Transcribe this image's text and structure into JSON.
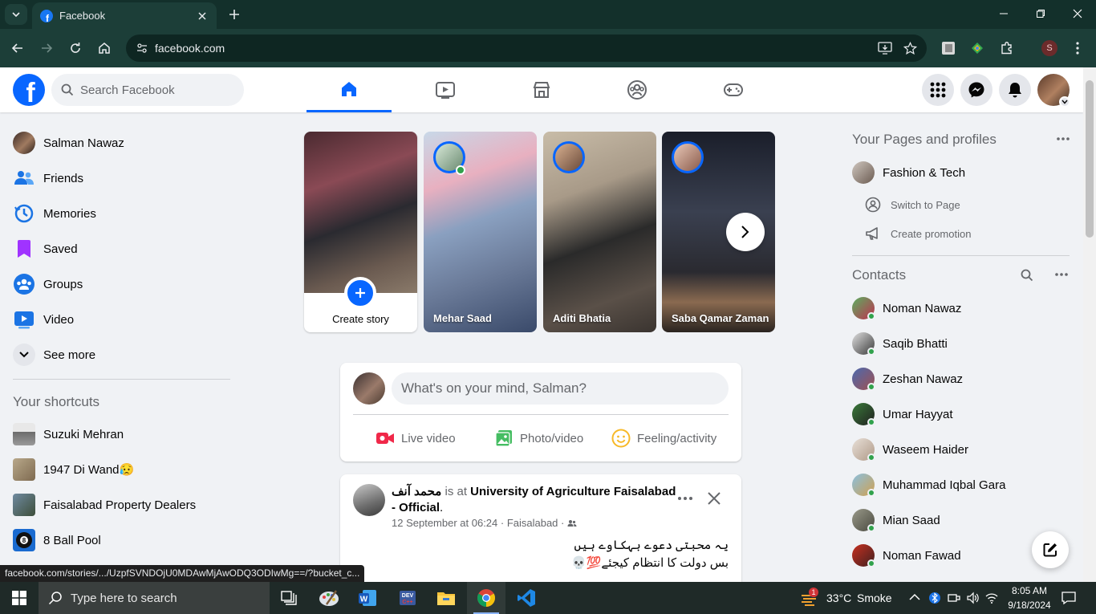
{
  "browser": {
    "tab_title": "Facebook",
    "url": "facebook.com",
    "profile_initial": "S",
    "status_url": "facebook.com/stories/.../UzpfSVNDOjU0MDAwMjAwODQ3ODIwMg==/?bucket_c..."
  },
  "header": {
    "logo_letter": "f",
    "search_placeholder": "Search Facebook",
    "nav_tabs": [
      "home-icon",
      "video-icon",
      "marketplace-icon",
      "groups-icon",
      "gaming-icon"
    ],
    "accent": "#0866ff"
  },
  "left": {
    "items": [
      {
        "label": "Salman Nawaz",
        "icon": "avatar"
      },
      {
        "label": "Friends",
        "icon": "friends-icon"
      },
      {
        "label": "Memories",
        "icon": "memories-icon"
      },
      {
        "label": "Saved",
        "icon": "saved-icon"
      },
      {
        "label": "Groups",
        "icon": "groups-icon"
      },
      {
        "label": "Video",
        "icon": "video-icon"
      },
      {
        "label": "See more",
        "icon": "chevron-down-icon"
      }
    ],
    "shortcuts_title": "Your shortcuts",
    "shortcuts": [
      {
        "label": "Suzuki Mehran"
      },
      {
        "label": "1947 Di Wand😥"
      },
      {
        "label": "Faisalabad Property Dealers"
      },
      {
        "label": "8 Ball Pool"
      }
    ]
  },
  "stories": {
    "create_label": "Create story",
    "items": [
      {
        "name": "Mehar Saad"
      },
      {
        "name": "Aditi Bhatia"
      },
      {
        "name": "Saba Qamar Zaman"
      }
    ]
  },
  "composer": {
    "placeholder": "What's on your mind, Salman?",
    "live_label": "Live video",
    "photo_label": "Photo/video",
    "feeling_label": "Feeling/activity"
  },
  "post": {
    "author": "محمد آنف",
    "is_at": " is at ",
    "place": "University of Agriculture Faisalabad - Official",
    "period": ".",
    "date": "12 September at 06:24 · Faisalabad ·",
    "line1": "یہ محبتی دعوے بہکاوے ہیں",
    "line2": "بس دولت کا انتظام کیجئے💯💀"
  },
  "right": {
    "pages_title": "Your Pages and profiles",
    "page_name": "Fashion & Tech",
    "switch_label": "Switch to Page",
    "promo_label": "Create promotion",
    "contacts_title": "Contacts",
    "contacts": [
      {
        "name": "Noman Nawaz"
      },
      {
        "name": "Saqib Bhatti"
      },
      {
        "name": "Zeshan Nawaz"
      },
      {
        "name": "Umar Hayyat"
      },
      {
        "name": "Waseem Haider"
      },
      {
        "name": "Muhammad Iqbal Gara"
      },
      {
        "name": "Mian Saad"
      },
      {
        "name": "Noman Fawad"
      }
    ]
  },
  "taskbar": {
    "search_placeholder": "Type here to search",
    "weather_temp": "33°C",
    "weather_text": "Smoke",
    "weather_badge": "1",
    "time": "8:05 AM",
    "date": "9/18/2024"
  }
}
